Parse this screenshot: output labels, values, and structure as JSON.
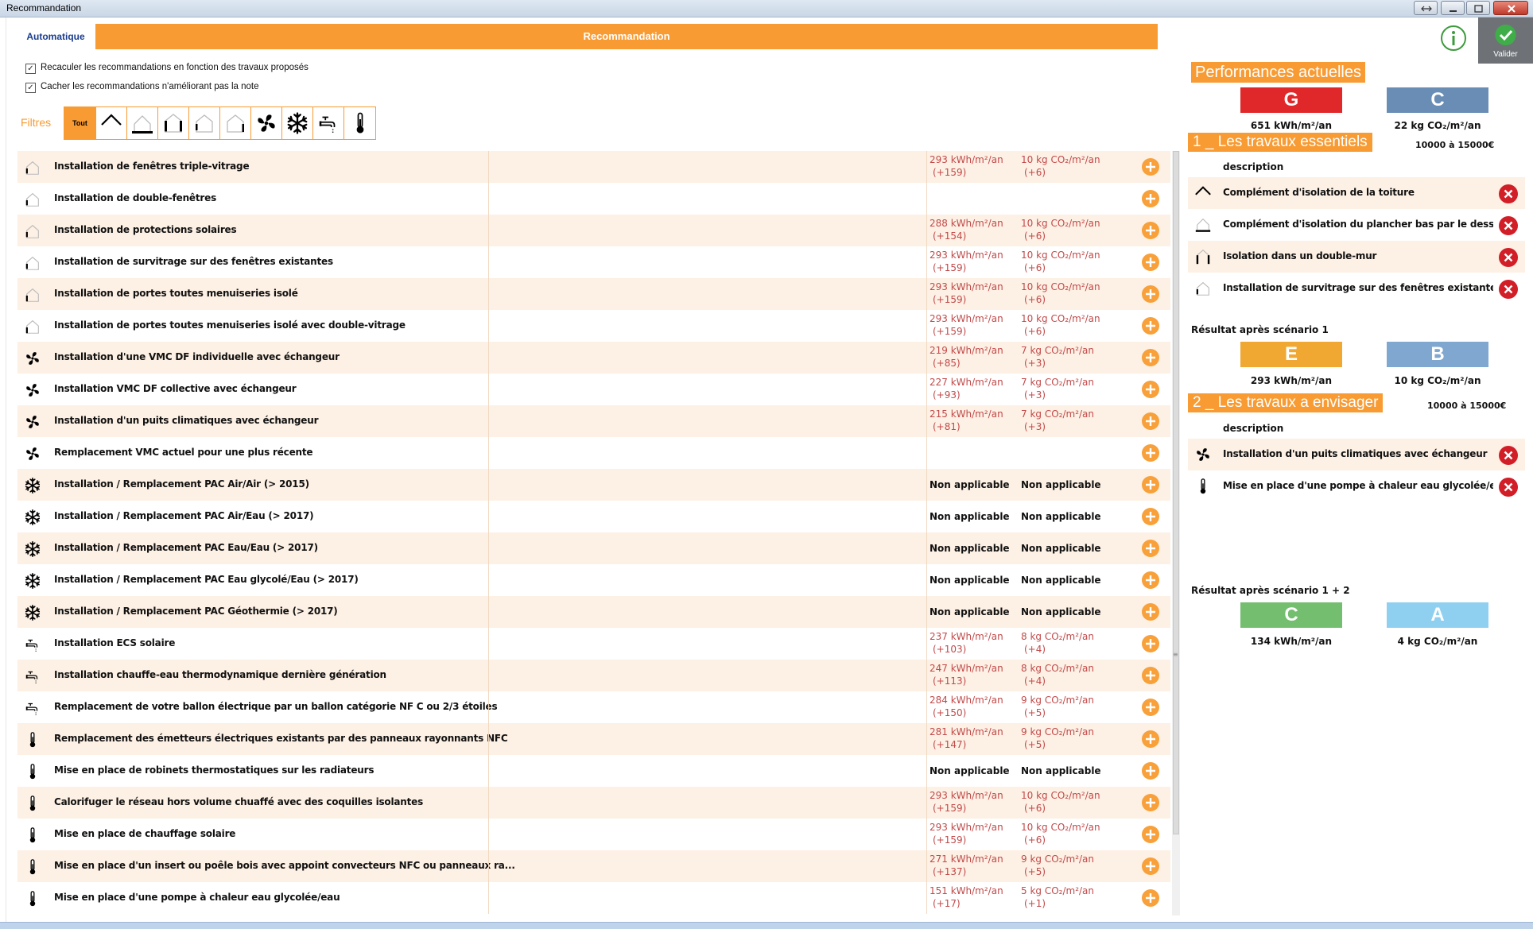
{
  "window": {
    "title": "Recommandation"
  },
  "mode_tab": "Automatique",
  "banner": "Recommandation",
  "validate": {
    "label": "Valider"
  },
  "options": [
    {
      "label": "Recaculer les recommandations en fonction des travaux proposés",
      "checked": true
    },
    {
      "label": "Cacher les recommandations n'améliorant pas la note",
      "checked": true
    }
  ],
  "filters": {
    "label": "Filtres",
    "all_label": "Tout",
    "items": [
      "roof-icon",
      "floor-icon",
      "wall-icon",
      "window-icon",
      "door-icon",
      "fan-icon",
      "snowflake-icon",
      "faucet-icon",
      "thermometer-icon"
    ]
  },
  "recommendations": [
    {
      "icon": "window-icon",
      "label": "Installation de fenêtres triple-vitrage",
      "kwh": "293 kWh/m²/an",
      "kwh_delta": "(+159)",
      "co2": "10 kg CO₂/m²/an",
      "co2_delta": "(+6)"
    },
    {
      "icon": "window-icon",
      "label": "Installation de double-fenêtres",
      "kwh": "",
      "kwh_delta": "",
      "co2": "",
      "co2_delta": ""
    },
    {
      "icon": "window-icon",
      "label": "Installation de protections solaires",
      "kwh": "288 kWh/m²/an",
      "kwh_delta": "(+154)",
      "co2": "10 kg CO₂/m²/an",
      "co2_delta": "(+6)"
    },
    {
      "icon": "window-icon",
      "label": "Installation de survitrage sur des fenêtres existantes",
      "kwh": "293 kWh/m²/an",
      "kwh_delta": "(+159)",
      "co2": "10 kg CO₂/m²/an",
      "co2_delta": "(+6)"
    },
    {
      "icon": "door-icon",
      "label": "Installation de portes toutes menuiseries isolé",
      "kwh": "293 kWh/m²/an",
      "kwh_delta": "(+159)",
      "co2": "10 kg CO₂/m²/an",
      "co2_delta": "(+6)"
    },
    {
      "icon": "door-icon",
      "label": "Installation de portes toutes menuiseries isolé avec double-vitrage",
      "kwh": "293 kWh/m²/an",
      "kwh_delta": "(+159)",
      "co2": "10 kg CO₂/m²/an",
      "co2_delta": "(+6)"
    },
    {
      "icon": "fan-icon",
      "label": "Installation d'une VMC DF individuelle avec échangeur",
      "kwh": "219 kWh/m²/an",
      "kwh_delta": "(+85)",
      "co2": "7 kg CO₂/m²/an",
      "co2_delta": "(+3)"
    },
    {
      "icon": "fan-icon",
      "label": "Installation VMC DF collective avec échangeur",
      "kwh": "227 kWh/m²/an",
      "kwh_delta": "(+93)",
      "co2": "7 kg CO₂/m²/an",
      "co2_delta": "(+3)"
    },
    {
      "icon": "fan-icon",
      "label": "Installation d'un puits climatiques avec échangeur",
      "kwh": "215 kWh/m²/an",
      "kwh_delta": "(+81)",
      "co2": "7 kg CO₂/m²/an",
      "co2_delta": "(+3)"
    },
    {
      "icon": "fan-icon",
      "label": "Remplacement VMC actuel pour une plus récente",
      "kwh": "",
      "kwh_delta": "",
      "co2": "",
      "co2_delta": ""
    },
    {
      "icon": "snowflake-icon",
      "label": "Installation / Remplacement PAC Air/Air (> 2015)",
      "na": "Non applicable"
    },
    {
      "icon": "snowflake-icon",
      "label": "Installation / Remplacement PAC Air/Eau (> 2017)",
      "na": "Non applicable"
    },
    {
      "icon": "snowflake-icon",
      "label": "Installation / Remplacement PAC Eau/Eau (> 2017)",
      "na": "Non applicable"
    },
    {
      "icon": "snowflake-icon",
      "label": "Installation / Remplacement PAC Eau glycolé/Eau (> 2017)",
      "na": "Non applicable"
    },
    {
      "icon": "snowflake-icon",
      "label": "Installation / Remplacement PAC Géothermie (> 2017)",
      "na": "Non applicable"
    },
    {
      "icon": "faucet-icon",
      "label": "Installation ECS solaire",
      "kwh": "237 kWh/m²/an",
      "kwh_delta": "(+103)",
      "co2": "8 kg CO₂/m²/an",
      "co2_delta": "(+4)"
    },
    {
      "icon": "faucet-icon",
      "label": "Installation chauffe-eau thermodynamique dernière génération",
      "kwh": "247 kWh/m²/an",
      "kwh_delta": "(+113)",
      "co2": "8 kg CO₂/m²/an",
      "co2_delta": "(+4)"
    },
    {
      "icon": "faucet-icon",
      "label": "Remplacement de votre ballon électrique par un ballon catégorie NF C ou 2/3 étoiles",
      "kwh": "284 kWh/m²/an",
      "kwh_delta": "(+150)",
      "co2": "9 kg CO₂/m²/an",
      "co2_delta": "(+5)"
    },
    {
      "icon": "thermometer-icon",
      "label": "Remplacement des émetteurs électriques existants par des panneaux rayonnants NFC",
      "kwh": "281 kWh/m²/an",
      "kwh_delta": "(+147)",
      "co2": "9 kg CO₂/m²/an",
      "co2_delta": "(+5)"
    },
    {
      "icon": "thermometer-icon",
      "label": "Mise en place de robinets thermostatiques sur les radiateurs",
      "na": "Non applicable"
    },
    {
      "icon": "thermometer-icon",
      "label": "Calorifuger le réseau hors volume chuaffé avec des coquilles isolantes",
      "kwh": "293 kWh/m²/an",
      "kwh_delta": "(+159)",
      "co2": "10 kg CO₂/m²/an",
      "co2_delta": "(+6)"
    },
    {
      "icon": "thermometer-icon",
      "label": "Mise en place de chauffage solaire",
      "kwh": "293 kWh/m²/an",
      "kwh_delta": "(+159)",
      "co2": "10 kg CO₂/m²/an",
      "co2_delta": "(+6)"
    },
    {
      "icon": "thermometer-icon",
      "label": "Mise en place d'un insert ou poêle bois avec appoint convecteurs NFC ou panneaux ra...",
      "kwh": "271 kWh/m²/an",
      "kwh_delta": "(+137)",
      "co2": "9 kg CO₂/m²/an",
      "co2_delta": "(+5)"
    },
    {
      "icon": "thermometer-icon",
      "label": "Mise en place d'une pompe à chaleur eau glycolée/eau",
      "kwh": "151 kWh/m²/an",
      "kwh_delta": "(+17)",
      "co2": "5 kg CO₂/m²/an",
      "co2_delta": "(+1)"
    }
  ],
  "performance": {
    "title": "Performances actuelles",
    "energy": {
      "label": "G",
      "value": "651 kWh/m²/an",
      "color": "#e0282a"
    },
    "climate": {
      "label": "C",
      "value": "22 kg CO₂/m²/an",
      "color": "#6a8db6"
    }
  },
  "scenario1": {
    "title": "1 _ Les travaux essentiels",
    "cost": "10000 à 15000€",
    "header": "description",
    "items": [
      {
        "icon": "roof-icon",
        "label": "Complément d'isolation de la toiture"
      },
      {
        "icon": "floor-icon",
        "label": "Complément d'isolation du plancher bas par le dess..."
      },
      {
        "icon": "wall-icon",
        "label": "Isolation dans un double-mur"
      },
      {
        "icon": "window-icon",
        "label": "Installation de survitrage sur des fenêtres existantes"
      }
    ],
    "result_title": "Résultat après scénario 1",
    "energy": {
      "label": "E",
      "value": "293 kWh/m²/an",
      "color": "#f0a833"
    },
    "climate": {
      "label": "B",
      "value": "10 kg CO₂/m²/an",
      "color": "#7fa7cf"
    }
  },
  "scenario2": {
    "title": "2 _ Les travaux a envisager",
    "cost": "10000 à 15000€",
    "header": "description",
    "items": [
      {
        "icon": "fan-icon",
        "label": "Installation d'un puits climatiques avec échangeur"
      },
      {
        "icon": "thermometer-icon",
        "label": "Mise en place d'une pompe à chaleur eau glycolée/e..."
      }
    ],
    "result_title": "Résultat après scénario 1 + 2",
    "energy": {
      "label": "C",
      "value": "134 kWh/m²/an",
      "color": "#74bf6f"
    },
    "climate": {
      "label": "A",
      "value": "4 kg CO₂/m²/an",
      "color": "#8fd0f0"
    }
  }
}
